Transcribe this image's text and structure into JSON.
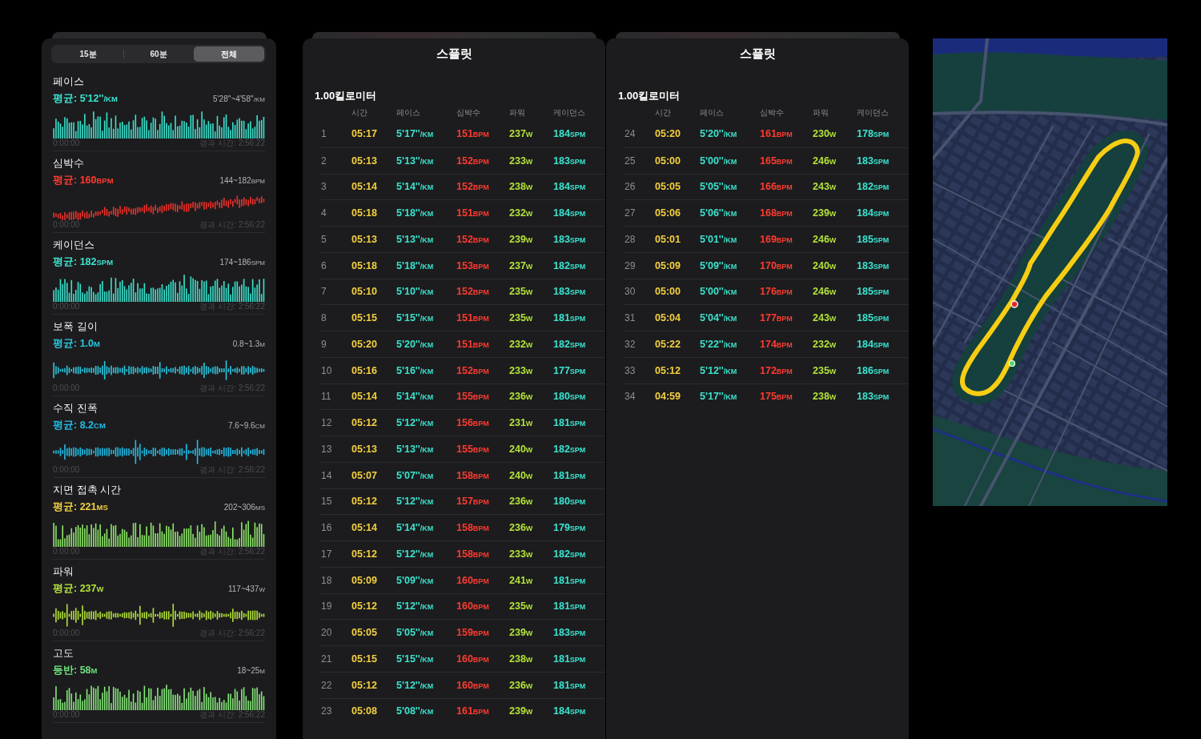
{
  "activity_panel": {
    "range_tabs": [
      {
        "label": "15분",
        "selected": false
      },
      {
        "label": "60분",
        "selected": false
      },
      {
        "label": "전체",
        "selected": true
      }
    ],
    "metrics": [
      {
        "title": "페이스",
        "average": {
          "text": "평균: 5'12''",
          "unit": "/KM"
        },
        "range": {
          "text": "5'28''~4'58''",
          "unit": "/KM"
        },
        "color": "#3be3cf",
        "chart": {
          "kind": "baseline",
          "color": "#3be3cf"
        },
        "start_time": "0:00:00",
        "elapsed": "경과 시간: 2:56:22"
      },
      {
        "title": "심박수",
        "average": {
          "text": "평균: 160",
          "unit": "BPM"
        },
        "range": {
          "text": "144~182",
          "unit": "BPM"
        },
        "color": "#ff3b30",
        "chart": {
          "kind": "range",
          "color": "#ee3129"
        },
        "start_time": "0:00:00",
        "elapsed": "경과 시간: 2:56:22"
      },
      {
        "title": "케이던스",
        "average": {
          "text": "평균: 182",
          "unit": "SPM"
        },
        "range": {
          "text": "174~186",
          "unit": "SPM"
        },
        "color": "#3be3cf",
        "chart": {
          "kind": "baseline",
          "color": "#3be3cf"
        },
        "start_time": "0:00:00",
        "elapsed": "경과 시간: 2:56:22"
      },
      {
        "title": "보폭 길이",
        "average": {
          "text": "평균: 1.0",
          "unit": "M"
        },
        "range": {
          "text": "0.8~1.3",
          "unit": "M"
        },
        "color": "#2ac8e0",
        "chart": {
          "kind": "centered",
          "color": "#2ac8e0"
        },
        "start_time": "0:00:00",
        "elapsed": "경과 시간: 2:56:22"
      },
      {
        "title": "수직 진폭",
        "average": {
          "text": "평균: 8.2",
          "unit": "CM"
        },
        "range": {
          "text": "7.6~9.6",
          "unit": "CM"
        },
        "color": "#22bde6",
        "chart": {
          "kind": "centered",
          "color": "#22bde6"
        },
        "start_time": "0:00:00",
        "elapsed": "경과 시간: 2:56:22"
      },
      {
        "title": "지면 접촉 시간",
        "average": {
          "text": "평균: 221",
          "unit": "MS"
        },
        "range": {
          "text": "202~306",
          "unit": "MS"
        },
        "color": "#f2cf3f",
        "chart": {
          "kind": "baseline",
          "color": "#8ee86a"
        },
        "start_time": "0:00:00",
        "elapsed": "경과 시간: 2:56:22"
      },
      {
        "title": "파워",
        "average": {
          "text": "평균: 237",
          "unit": "W"
        },
        "range": {
          "text": "117~437",
          "unit": "W"
        },
        "color": "#b4e33a",
        "chart": {
          "kind": "centered",
          "color": "#b4e33a"
        },
        "start_time": "0:00:00",
        "elapsed": "경과 시간: 2:56:22"
      },
      {
        "title": "고도",
        "average": {
          "text": "등반: 58",
          "unit": "M"
        },
        "range": {
          "text": "18~25",
          "unit": "M"
        },
        "color": "#6ee07a",
        "chart": {
          "kind": "baseline",
          "color": "#86e87a"
        },
        "start_time": "0:00:00",
        "elapsed": "경과 시간: 2:56:22"
      }
    ]
  },
  "splits_panels": [
    {
      "title": "스플릿",
      "subtitle": "1.00킬로미터",
      "columns": [
        {
          "label": "시간",
          "color": "#f4d03f"
        },
        {
          "label": "페이스",
          "color": "#3be3cf"
        },
        {
          "label": "심박수",
          "color": "#ff3b30"
        },
        {
          "label": "파워",
          "color": "#b4e33a"
        },
        {
          "label": "케이던스",
          "color": "#3be3cf"
        }
      ],
      "rows": [
        {
          "index": "1",
          "cells": [
            {
              "value": "05:17"
            },
            {
              "value": "5'17''",
              "unit": "/KM"
            },
            {
              "value": "151",
              "unit": "BPM"
            },
            {
              "value": "237",
              "unit": "W"
            },
            {
              "value": "184",
              "unit": "SPM"
            }
          ]
        },
        {
          "index": "2",
          "cells": [
            {
              "value": "05:13"
            },
            {
              "value": "5'13''",
              "unit": "/KM"
            },
            {
              "value": "152",
              "unit": "BPM"
            },
            {
              "value": "233",
              "unit": "W"
            },
            {
              "value": "183",
              "unit": "SPM"
            }
          ]
        },
        {
          "index": "3",
          "cells": [
            {
              "value": "05:14"
            },
            {
              "value": "5'14''",
              "unit": "/KM"
            },
            {
              "value": "152",
              "unit": "BPM"
            },
            {
              "value": "238",
              "unit": "W"
            },
            {
              "value": "184",
              "unit": "SPM"
            }
          ]
        },
        {
          "index": "4",
          "cells": [
            {
              "value": "05:18"
            },
            {
              "value": "5'18''",
              "unit": "/KM"
            },
            {
              "value": "151",
              "unit": "BPM"
            },
            {
              "value": "232",
              "unit": "W"
            },
            {
              "value": "184",
              "unit": "SPM"
            }
          ]
        },
        {
          "index": "5",
          "cells": [
            {
              "value": "05:13"
            },
            {
              "value": "5'13''",
              "unit": "/KM"
            },
            {
              "value": "152",
              "unit": "BPM"
            },
            {
              "value": "239",
              "unit": "W"
            },
            {
              "value": "183",
              "unit": "SPM"
            }
          ]
        },
        {
          "index": "6",
          "cells": [
            {
              "value": "05:18"
            },
            {
              "value": "5'18''",
              "unit": "/KM"
            },
            {
              "value": "153",
              "unit": "BPM"
            },
            {
              "value": "237",
              "unit": "W"
            },
            {
              "value": "182",
              "unit": "SPM"
            }
          ]
        },
        {
          "index": "7",
          "cells": [
            {
              "value": "05:10"
            },
            {
              "value": "5'10''",
              "unit": "/KM"
            },
            {
              "value": "152",
              "unit": "BPM"
            },
            {
              "value": "235",
              "unit": "W"
            },
            {
              "value": "183",
              "unit": "SPM"
            }
          ]
        },
        {
          "index": "8",
          "cells": [
            {
              "value": "05:15"
            },
            {
              "value": "5'15''",
              "unit": "/KM"
            },
            {
              "value": "151",
              "unit": "BPM"
            },
            {
              "value": "235",
              "unit": "W"
            },
            {
              "value": "181",
              "unit": "SPM"
            }
          ]
        },
        {
          "index": "9",
          "cells": [
            {
              "value": "05:20"
            },
            {
              "value": "5'20''",
              "unit": "/KM"
            },
            {
              "value": "151",
              "unit": "BPM"
            },
            {
              "value": "232",
              "unit": "W"
            },
            {
              "value": "182",
              "unit": "SPM"
            }
          ]
        },
        {
          "index": "10",
          "cells": [
            {
              "value": "05:16"
            },
            {
              "value": "5'16''",
              "unit": "/KM"
            },
            {
              "value": "152",
              "unit": "BPM"
            },
            {
              "value": "233",
              "unit": "W"
            },
            {
              "value": "177",
              "unit": "SPM"
            }
          ]
        },
        {
          "index": "11",
          "cells": [
            {
              "value": "05:14"
            },
            {
              "value": "5'14''",
              "unit": "/KM"
            },
            {
              "value": "155",
              "unit": "BPM"
            },
            {
              "value": "236",
              "unit": "W"
            },
            {
              "value": "180",
              "unit": "SPM"
            }
          ]
        },
        {
          "index": "12",
          "cells": [
            {
              "value": "05:12"
            },
            {
              "value": "5'12''",
              "unit": "/KM"
            },
            {
              "value": "156",
              "unit": "BPM"
            },
            {
              "value": "231",
              "unit": "W"
            },
            {
              "value": "181",
              "unit": "SPM"
            }
          ]
        },
        {
          "index": "13",
          "cells": [
            {
              "value": "05:13"
            },
            {
              "value": "5'13''",
              "unit": "/KM"
            },
            {
              "value": "155",
              "unit": "BPM"
            },
            {
              "value": "240",
              "unit": "W"
            },
            {
              "value": "182",
              "unit": "SPM"
            }
          ]
        },
        {
          "index": "14",
          "cells": [
            {
              "value": "05:07"
            },
            {
              "value": "5'07''",
              "unit": "/KM"
            },
            {
              "value": "158",
              "unit": "BPM"
            },
            {
              "value": "240",
              "unit": "W"
            },
            {
              "value": "181",
              "unit": "SPM"
            }
          ]
        },
        {
          "index": "15",
          "cells": [
            {
              "value": "05:12"
            },
            {
              "value": "5'12''",
              "unit": "/KM"
            },
            {
              "value": "157",
              "unit": "BPM"
            },
            {
              "value": "236",
              "unit": "W"
            },
            {
              "value": "180",
              "unit": "SPM"
            }
          ]
        },
        {
          "index": "16",
          "cells": [
            {
              "value": "05:14"
            },
            {
              "value": "5'14''",
              "unit": "/KM"
            },
            {
              "value": "158",
              "unit": "BPM"
            },
            {
              "value": "236",
              "unit": "W"
            },
            {
              "value": "179",
              "unit": "SPM"
            }
          ]
        },
        {
          "index": "17",
          "cells": [
            {
              "value": "05:12"
            },
            {
              "value": "5'12''",
              "unit": "/KM"
            },
            {
              "value": "158",
              "unit": "BPM"
            },
            {
              "value": "233",
              "unit": "W"
            },
            {
              "value": "182",
              "unit": "SPM"
            }
          ]
        },
        {
          "index": "18",
          "cells": [
            {
              "value": "05:09"
            },
            {
              "value": "5'09''",
              "unit": "/KM"
            },
            {
              "value": "160",
              "unit": "BPM"
            },
            {
              "value": "241",
              "unit": "W"
            },
            {
              "value": "181",
              "unit": "SPM"
            }
          ]
        },
        {
          "index": "19",
          "cells": [
            {
              "value": "05:12"
            },
            {
              "value": "5'12''",
              "unit": "/KM"
            },
            {
              "value": "160",
              "unit": "BPM"
            },
            {
              "value": "235",
              "unit": "W"
            },
            {
              "value": "181",
              "unit": "SPM"
            }
          ]
        },
        {
          "index": "20",
          "cells": [
            {
              "value": "05:05"
            },
            {
              "value": "5'05''",
              "unit": "/KM"
            },
            {
              "value": "159",
              "unit": "BPM"
            },
            {
              "value": "239",
              "unit": "W"
            },
            {
              "value": "183",
              "unit": "SPM"
            }
          ]
        },
        {
          "index": "21",
          "cells": [
            {
              "value": "05:15"
            },
            {
              "value": "5'15''",
              "unit": "/KM"
            },
            {
              "value": "160",
              "unit": "BPM"
            },
            {
              "value": "238",
              "unit": "W"
            },
            {
              "value": "181",
              "unit": "SPM"
            }
          ]
        },
        {
          "index": "22",
          "cells": [
            {
              "value": "05:12"
            },
            {
              "value": "5'12''",
              "unit": "/KM"
            },
            {
              "value": "160",
              "unit": "BPM"
            },
            {
              "value": "236",
              "unit": "W"
            },
            {
              "value": "181",
              "unit": "SPM"
            }
          ]
        },
        {
          "index": "23",
          "cells": [
            {
              "value": "05:08"
            },
            {
              "value": "5'08''",
              "unit": "/KM"
            },
            {
              "value": "161",
              "unit": "BPM"
            },
            {
              "value": "239",
              "unit": "W"
            },
            {
              "value": "184",
              "unit": "SPM"
            }
          ]
        }
      ]
    },
    {
      "title": "스플릿",
      "subtitle": "1.00킬로미터",
      "columns": [
        {
          "label": "시간",
          "color": "#f4d03f"
        },
        {
          "label": "페이스",
          "color": "#3be3cf"
        },
        {
          "label": "심박수",
          "color": "#ff3b30"
        },
        {
          "label": "파워",
          "color": "#b4e33a"
        },
        {
          "label": "케이던스",
          "color": "#3be3cf"
        }
      ],
      "rows": [
        {
          "index": "24",
          "cells": [
            {
              "value": "05:20"
            },
            {
              "value": "5'20''",
              "unit": "/KM"
            },
            {
              "value": "161",
              "unit": "BPM"
            },
            {
              "value": "230",
              "unit": "W"
            },
            {
              "value": "178",
              "unit": "SPM"
            }
          ]
        },
        {
          "index": "25",
          "cells": [
            {
              "value": "05:00"
            },
            {
              "value": "5'00''",
              "unit": "/KM"
            },
            {
              "value": "165",
              "unit": "BPM"
            },
            {
              "value": "246",
              "unit": "W"
            },
            {
              "value": "183",
              "unit": "SPM"
            }
          ]
        },
        {
          "index": "26",
          "cells": [
            {
              "value": "05:05"
            },
            {
              "value": "5'05''",
              "unit": "/KM"
            },
            {
              "value": "166",
              "unit": "BPM"
            },
            {
              "value": "243",
              "unit": "W"
            },
            {
              "value": "182",
              "unit": "SPM"
            }
          ]
        },
        {
          "index": "27",
          "cells": [
            {
              "value": "05:06"
            },
            {
              "value": "5'06''",
              "unit": "/KM"
            },
            {
              "value": "168",
              "unit": "BPM"
            },
            {
              "value": "239",
              "unit": "W"
            },
            {
              "value": "184",
              "unit": "SPM"
            }
          ]
        },
        {
          "index": "28",
          "cells": [
            {
              "value": "05:01"
            },
            {
              "value": "5'01''",
              "unit": "/KM"
            },
            {
              "value": "169",
              "unit": "BPM"
            },
            {
              "value": "246",
              "unit": "W"
            },
            {
              "value": "185",
              "unit": "SPM"
            }
          ]
        },
        {
          "index": "29",
          "cells": [
            {
              "value": "05:09"
            },
            {
              "value": "5'09''",
              "unit": "/KM"
            },
            {
              "value": "170",
              "unit": "BPM"
            },
            {
              "value": "240",
              "unit": "W"
            },
            {
              "value": "183",
              "unit": "SPM"
            }
          ]
        },
        {
          "index": "30",
          "cells": [
            {
              "value": "05:00"
            },
            {
              "value": "5'00''",
              "unit": "/KM"
            },
            {
              "value": "176",
              "unit": "BPM"
            },
            {
              "value": "246",
              "unit": "W"
            },
            {
              "value": "185",
              "unit": "SPM"
            }
          ]
        },
        {
          "index": "31",
          "cells": [
            {
              "value": "05:04"
            },
            {
              "value": "5'04''",
              "unit": "/KM"
            },
            {
              "value": "177",
              "unit": "BPM"
            },
            {
              "value": "243",
              "unit": "W"
            },
            {
              "value": "185",
              "unit": "SPM"
            }
          ]
        },
        {
          "index": "32",
          "cells": [
            {
              "value": "05:22"
            },
            {
              "value": "5'22''",
              "unit": "/KM"
            },
            {
              "value": "174",
              "unit": "BPM"
            },
            {
              "value": "232",
              "unit": "W"
            },
            {
              "value": "184",
              "unit": "SPM"
            }
          ]
        },
        {
          "index": "33",
          "cells": [
            {
              "value": "05:12"
            },
            {
              "value": "5'12''",
              "unit": "/KM"
            },
            {
              "value": "172",
              "unit": "BPM"
            },
            {
              "value": "235",
              "unit": "W"
            },
            {
              "value": "186",
              "unit": "SPM"
            }
          ]
        },
        {
          "index": "34",
          "cells": [
            {
              "value": "04:59"
            },
            {
              "value": "5'17''",
              "unit": "/KM"
            },
            {
              "value": "175",
              "unit": "BPM"
            },
            {
              "value": "238",
              "unit": "W"
            },
            {
              "value": "183",
              "unit": "SPM"
            }
          ]
        }
      ]
    }
  ]
}
